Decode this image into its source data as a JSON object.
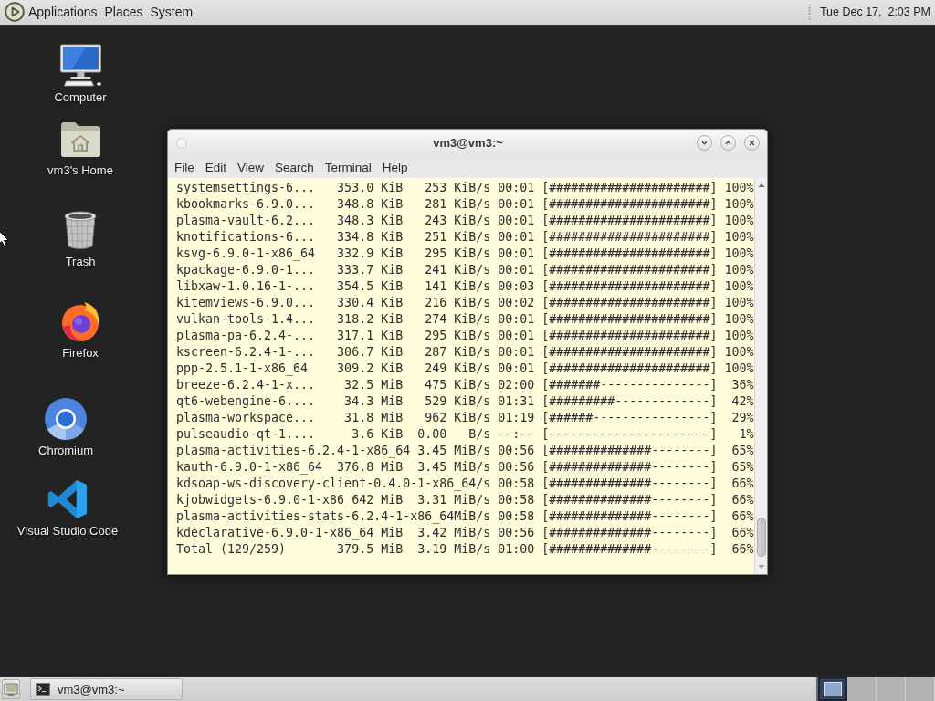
{
  "top_panel": {
    "menus": [
      "Applications",
      "Places",
      "System"
    ],
    "clock": "Tue Dec 17,  2:03 PM"
  },
  "desktop_icons": [
    {
      "kind": "computer",
      "label": "Computer"
    },
    {
      "kind": "home",
      "label": "vm3's Home"
    },
    {
      "kind": "trash",
      "label": "Trash"
    },
    {
      "kind": "firefox",
      "label": "Firefox"
    },
    {
      "kind": "chromium",
      "label": "Chromium"
    },
    {
      "kind": "vscode",
      "label": "Visual Studio Code"
    }
  ],
  "window": {
    "title": "vm3@vm3:~",
    "menu": [
      "File",
      "Edit",
      "View",
      "Search",
      "Terminal",
      "Help"
    ],
    "lines": [
      "systemsettings-6...   353.0 KiB   253 KiB/s 00:01 [######################] 100%",
      "kbookmarks-6.9.0...   348.8 KiB   281 KiB/s 00:01 [######################] 100%",
      "plasma-vault-6.2...   348.3 KiB   243 KiB/s 00:01 [######################] 100%",
      "knotifications-6...   334.8 KiB   251 KiB/s 00:01 [######################] 100%",
      "ksvg-6.9.0-1-x86_64   332.9 KiB   295 KiB/s 00:01 [######################] 100%",
      "kpackage-6.9.0-1...   333.7 KiB   241 KiB/s 00:01 [######################] 100%",
      "libxaw-1.0.16-1-...   354.5 KiB   141 KiB/s 00:03 [######################] 100%",
      "kitemviews-6.9.0...   330.4 KiB   216 KiB/s 00:02 [######################] 100%",
      "vulkan-tools-1.4...   318.2 KiB   274 KiB/s 00:01 [######################] 100%",
      "plasma-pa-6.2.4-...   317.1 KiB   295 KiB/s 00:01 [######################] 100%",
      "kscreen-6.2.4-1-...   306.7 KiB   287 KiB/s 00:01 [######################] 100%",
      "ppp-2.5.1-1-x86_64    309.2 KiB   249 KiB/s 00:01 [######################] 100%",
      "breeze-6.2.4-1-x...    32.5 MiB   475 KiB/s 02:00 [#######---------------]  36%",
      "qt6-webengine-6....    34.3 MiB   529 KiB/s 01:31 [#########-------------]  42%",
      "plasma-workspace...    31.8 MiB   962 KiB/s 01:19 [######----------------]  29%",
      "pulseaudio-qt-1....     3.6 KiB  0.00   B/s --:-- [----------------------]   1%",
      "plasma-activities-6.2.4-1-x86_64 3.45 MiB/s 00:56 [##############--------]  65%",
      "kauth-6.9.0-1-x86_64  376.8 MiB  3.45 MiB/s 00:56 [##############--------]  65%",
      "kdsoap-ws-discovery-client-0.4.0-1-x86_64/s 00:58 [##############--------]  66%",
      "kjobwidgets-6.9.0-1-x86_642 MiB  3.31 MiB/s 00:58 [##############--------]  66%",
      "plasma-activities-stats-6.2.4-1-x86_64MiB/s 00:58 [##############--------]  66%",
      "kdeclarative-6.9.0-1-x86_64 MiB  3.42 MiB/s 00:56 [##############--------]  66%",
      "Total (129/259)       379.5 MiB  3.19 MiB/s 01:00 [##############--------]  66%"
    ]
  },
  "bottom_panel": {
    "tasks": [
      {
        "label": "vm3@vm3:~"
      }
    ],
    "workspaces": [
      {
        "selected": true
      },
      {
        "selected": false
      },
      {
        "selected": false
      },
      {
        "selected": false
      }
    ]
  }
}
